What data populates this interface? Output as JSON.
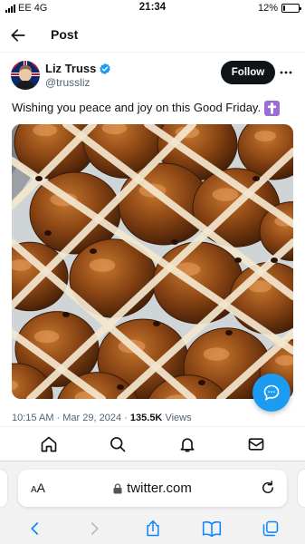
{
  "status": {
    "carrier": "EE",
    "network": "4G",
    "time": "21:34",
    "battery": "12%",
    "battery_level": 0.12
  },
  "header": {
    "title": "Post",
    "back_icon": "arrow-left-icon"
  },
  "tweet": {
    "author_name": "Liz Truss",
    "handle": "@trussliz",
    "verified": true,
    "follow_label": "Follow",
    "text": "Wishing you peace and joy on this Good Friday.",
    "emoji_icon": "latin-cross-icon",
    "time": "10:15 AM",
    "date": "Mar 29, 2024",
    "separator": "·",
    "views_count": "135.5K",
    "views_label": "Views"
  },
  "browser": {
    "text_size_small": "A",
    "text_size_large": "A",
    "url": "twitter.com"
  },
  "colors": {
    "accent": "#1d9bf0",
    "text": "#0f1419",
    "muted": "#536471",
    "ios_blue": "#0a84ff",
    "cross_purple": "#9b6bd6"
  }
}
